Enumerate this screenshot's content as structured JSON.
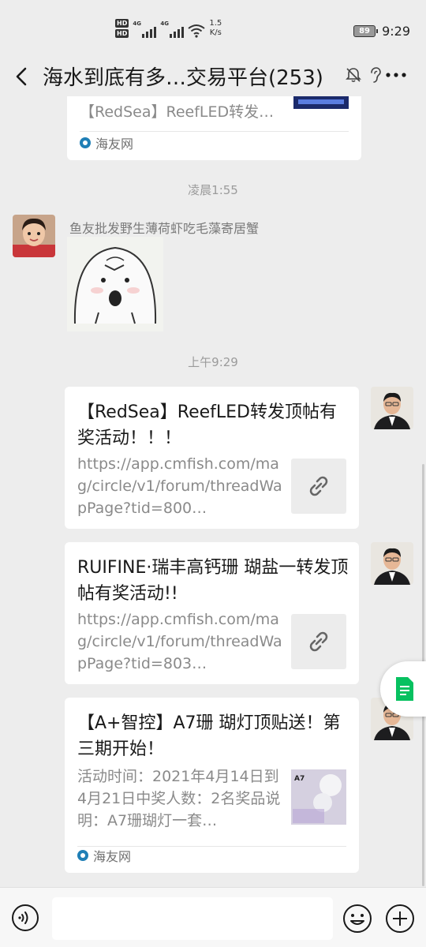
{
  "status": {
    "hd1": "HD",
    "hd2": "HD",
    "net1": "4G",
    "net2": "4G",
    "speed_value": "1.5",
    "speed_unit": "K/s",
    "battery": "89",
    "time": "9:29"
  },
  "header": {
    "title": "海水到底有多…交易平台(253)",
    "icons": [
      "back-icon",
      "mute-bell-icon",
      "ear-icon",
      "more-icon"
    ]
  },
  "messages": {
    "top_card": {
      "title": "【RedSea】ReefLED转发…",
      "source": "海友网"
    },
    "time1": "凌晨1:55",
    "sticker_msg": {
      "sender": "鱼友批发野生薄荷虾吃毛藻寄居蟹"
    },
    "time2": "上午9:29",
    "link1": {
      "title": "【RedSea】ReefLED转发顶帖有奖活动！！！",
      "desc": "https://app.cmfish.com/mag/circle/v1/forum/threadWapPage?tid=800…"
    },
    "link2": {
      "title": "RUIFINE·瑞丰高钙珊 瑚盐一转发顶帖有奖活动!!",
      "desc": "https://app.cmfish.com/mag/circle/v1/forum/threadWapPage?tid=803…"
    },
    "link3": {
      "title": "【A+智控】A7珊 瑚灯顶贴送！第三期开始！",
      "desc": "活动时间：2021年4月14日到4月21日中奖人数：2名奖品说明：A7珊瑚灯一套…",
      "source": "海友网",
      "thumb_text": "A7"
    }
  },
  "colors": {
    "background": "#ededed",
    "bubble": "#ffffff",
    "muted_text": "#8a8a8a",
    "float_button_accent": "#07c160"
  }
}
